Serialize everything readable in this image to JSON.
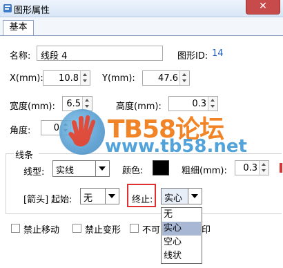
{
  "window": {
    "title": "图形属性",
    "close_symbol": "✕"
  },
  "tabs": [
    {
      "label": "基本"
    }
  ],
  "name": {
    "label": "名称:",
    "value": "线段 4"
  },
  "shape_id": {
    "label": "图形ID:",
    "value": "14"
  },
  "x": {
    "label": "X(mm):",
    "value": "10.8"
  },
  "y": {
    "label": "Y(mm):",
    "value": "47.6"
  },
  "width": {
    "label": "宽度(mm):",
    "value": "6.5"
  },
  "height": {
    "label": "高度(mm):",
    "value": "0.3"
  },
  "angle": {
    "label": "角度:",
    "value": "0"
  },
  "line": {
    "group_label": "线条",
    "type_label": "线型:",
    "type_value": "实线",
    "color_label": "颜色:",
    "color_value": "#000000",
    "thickness_label": "粗细(mm):",
    "thickness_value": "0.3"
  },
  "arrow": {
    "label": "[箭头]",
    "start_label": "起始:",
    "start_value": "无",
    "end_label": "终止:",
    "end_value": "实心",
    "end_options": [
      "无",
      "实心",
      "空心",
      "线状"
    ],
    "end_selected_index": 1
  },
  "options": [
    {
      "label": "禁止移动",
      "checked": false
    },
    {
      "label": "禁止变形",
      "checked": false
    },
    {
      "label": "不可",
      "checked": false
    }
  ],
  "partial_text": "印",
  "watermark": {
    "title": "TB58论坛",
    "url": "www.tb58.net"
  },
  "colors": {
    "accent_id": "#1f5fbf",
    "highlight_box": "#e03030",
    "selected_item": "#a8b8d4"
  }
}
